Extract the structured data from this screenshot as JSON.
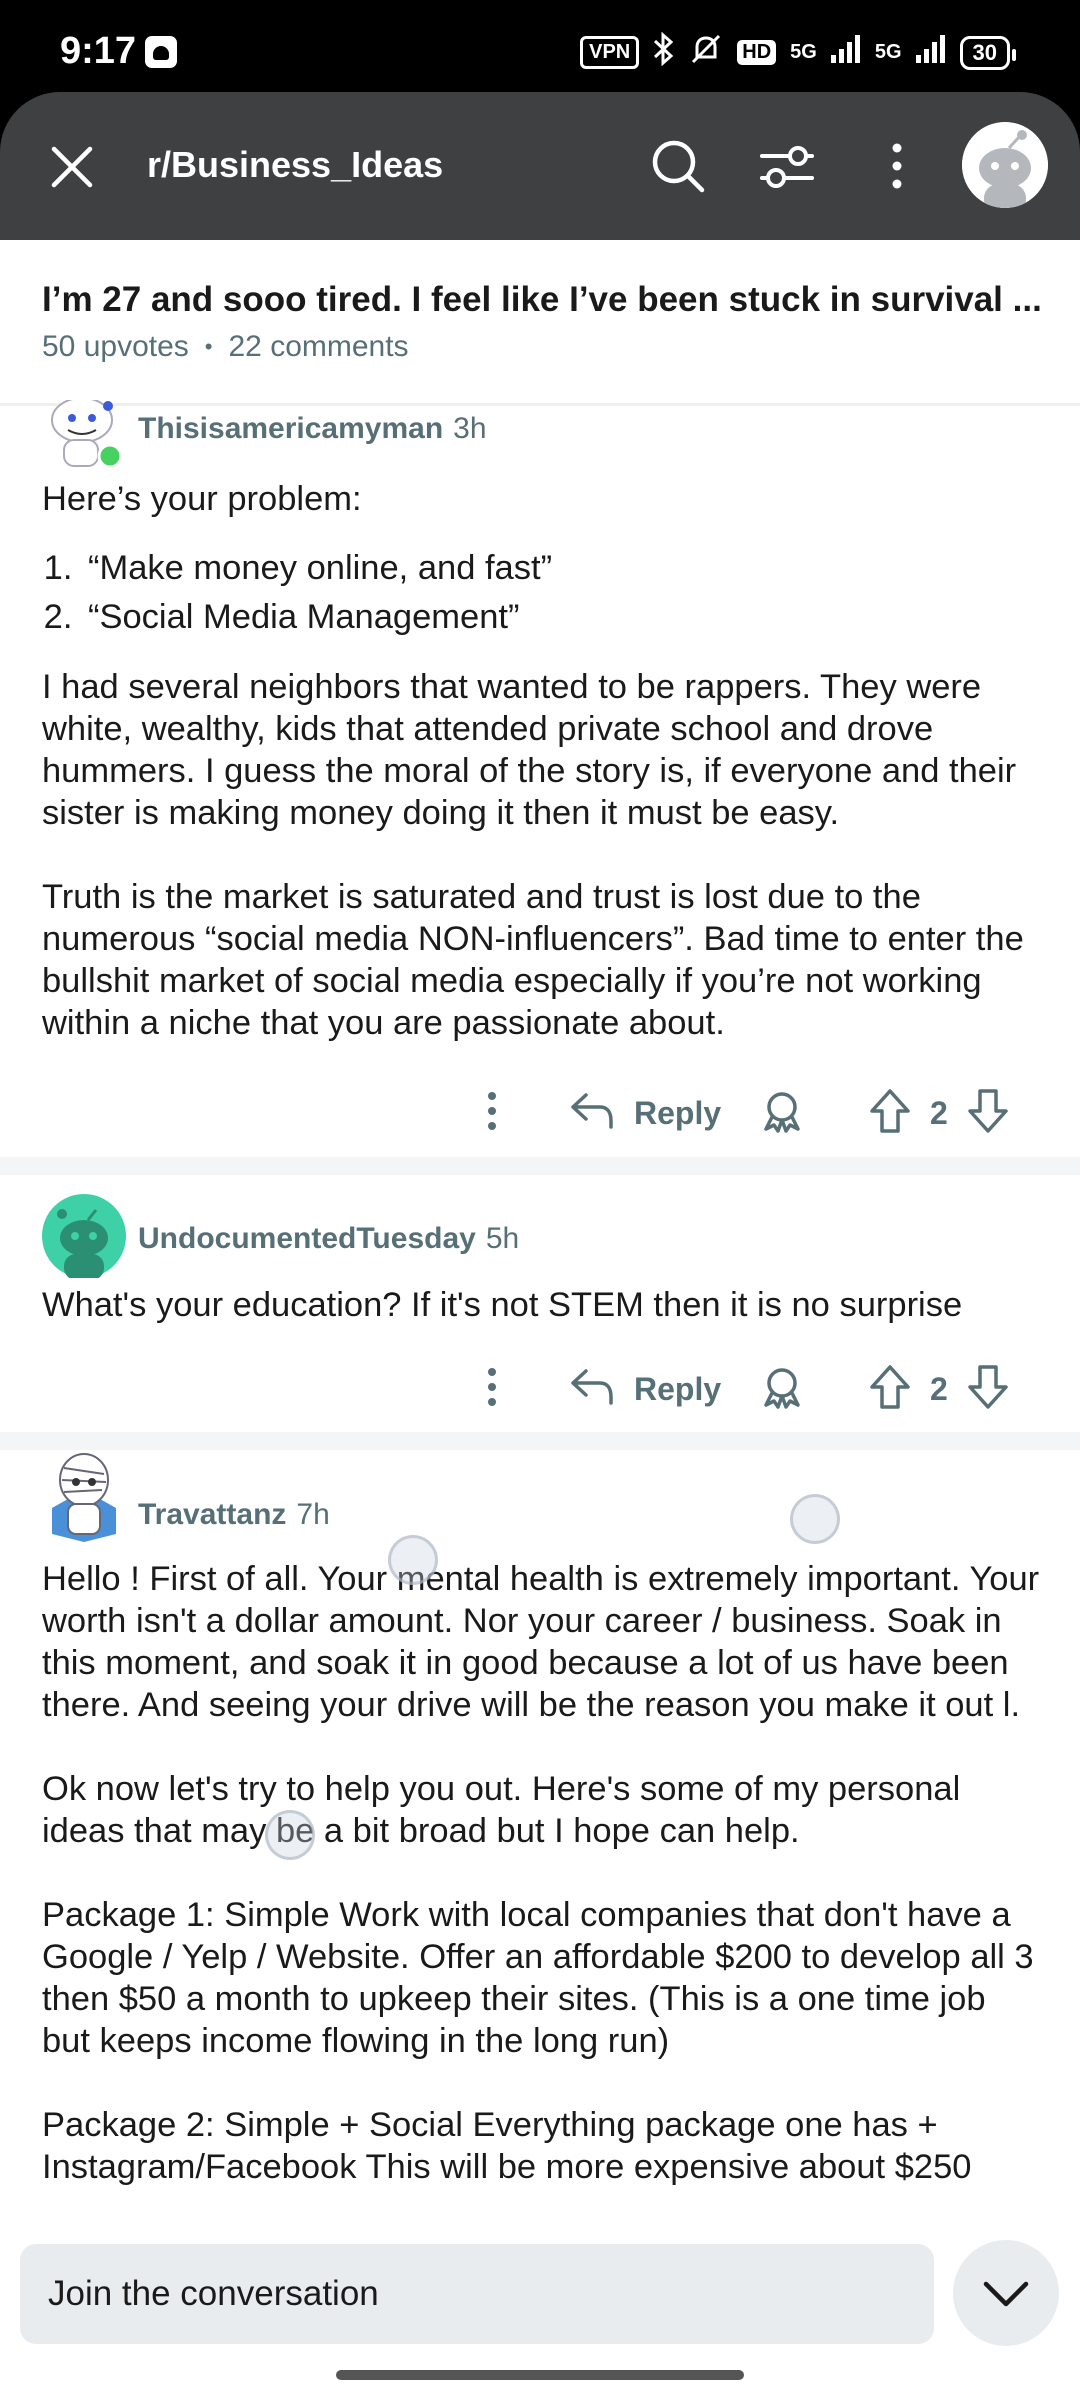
{
  "status_bar": {
    "time": "9:17",
    "vpn": "VPN",
    "hd": "HD",
    "net1": "5G",
    "net2": "5G",
    "battery": "30"
  },
  "header": {
    "subreddit": "r/Business_Ideas"
  },
  "post": {
    "title": "I’m 27 and sooo tired. I feel like I’ve been stuck in survival ...",
    "upvotes": "50 upvotes",
    "dot": "•",
    "comments": "22 comments"
  },
  "comments": [
    {
      "author": "Thisisamericamyman",
      "age": "3h",
      "intro": "Here’s your problem:",
      "list": [
        "“Make money online, and fast”",
        "“Social Media Management”"
      ],
      "paragraphs": [
        "I had several neighbors that wanted to be rappers. They were white, wealthy, kids that attended private school and drove hummers. I guess the moral of the story is, if everyone and their sister is making money doing it then it must be easy.",
        "Truth is the market is saturated and trust is lost due to the numerous “social media NON-influencers”. Bad time to enter the bullshit market of social media especially if you’re not working within a niche that you are passionate about."
      ],
      "reply_label": "Reply",
      "score": "2"
    },
    {
      "author": "UndocumentedTuesday",
      "age": "5h",
      "paragraphs": [
        "What's your education? If it's not STEM then it is no surprise"
      ],
      "reply_label": "Reply",
      "score": "2"
    },
    {
      "author": "Travattanz",
      "age": "7h",
      "paragraphs": [
        "Hello ! First of all. Your mental health is extremely important. Your worth isn't a dollar amount. Nor your career / business. Soak in this moment, and soak it in good because a lot of us have been there. And seeing your drive will be the reason you make it out l.",
        "Ok now let's try to help you out. Here's some of my personal ideas that may be a bit broad but I hope can help.",
        "Package 1: Simple Work with local companies that don't have a Google / Yelp / Website. Offer an affordable $200 to develop all 3 then $50 a month to upkeep their sites. (This is a one time job but keeps income flowing in the long run)",
        "Package 2: Simple + Social Everything package one has + Instagram/Facebook This will be more expensive about $250"
      ]
    }
  ],
  "bottom": {
    "join_placeholder": "Join the conversation"
  },
  "colors": {
    "header_bg": "#3f4042",
    "meta_gray": "#576f76",
    "avatar_green": "#46d160",
    "avatar_teal": "#3ed0a6"
  }
}
